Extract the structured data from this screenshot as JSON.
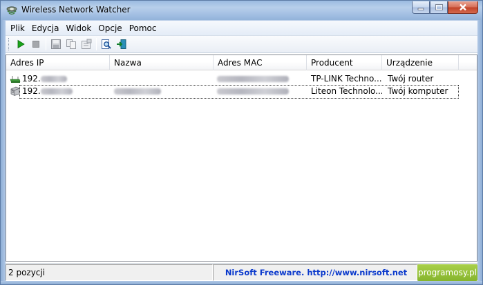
{
  "window": {
    "title": "Wireless Network Watcher"
  },
  "menu": [
    {
      "label": "Plik"
    },
    {
      "label": "Edycja"
    },
    {
      "label": "Widok"
    },
    {
      "label": "Opcje"
    },
    {
      "label": "Pomoc"
    }
  ],
  "toolbar": {
    "icons": [
      "play-icon",
      "stop-icon",
      "save-icon",
      "copy-icon",
      "properties-icon",
      "find-icon",
      "exit-icon"
    ]
  },
  "list": {
    "columns": [
      "Adres IP",
      "Nazwa",
      "Adres MAC",
      "Producent",
      "Urządzenie"
    ],
    "rows": [
      {
        "ip": "192.",
        "name": "",
        "mac": "",
        "producer": "TP-LINK Techno...",
        "device": "Twój router",
        "icon": "router-icon"
      },
      {
        "ip": "192.",
        "name": "",
        "mac": "",
        "producer": "Liteon Technolo...",
        "device": "Twój komputer",
        "icon": "computer-icon"
      }
    ]
  },
  "status": {
    "count": "2 pozycji",
    "link": "NirSoft Freeware.  http://www.nirsoft.net",
    "watermark": "programosy.pl"
  },
  "colors": {
    "link": "#0a39cc",
    "watermark_bg": "#95c13a",
    "play": "#1aa51a"
  }
}
